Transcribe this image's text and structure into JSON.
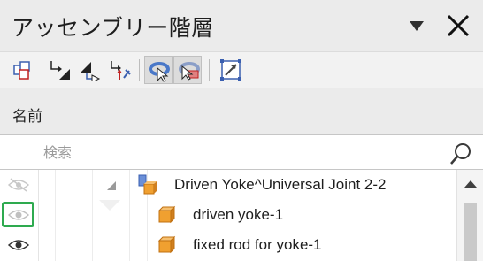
{
  "window": {
    "title": "アッセンブリー階層",
    "dropdown_icon": "chevron-down-icon",
    "close_icon": "close-icon"
  },
  "toolbar": {
    "buttons": [
      {
        "icon": "assembly-structure-icon",
        "toggled": false
      },
      {
        "icon": "sort-hierarchy-icon",
        "toggled": false
      },
      {
        "icon": "expand-collapse-icon",
        "toggled": false
      },
      {
        "icon": "constraint-link-icon",
        "toggled": false
      },
      {
        "icon": "select-ring-icon",
        "toggled": true
      },
      {
        "icon": "deselect-ring-icon",
        "toggled": true
      },
      {
        "icon": "fit-view-icon",
        "toggled": false
      }
    ]
  },
  "column_header": {
    "label": "名前"
  },
  "search": {
    "placeholder": "検索",
    "value": "",
    "icon": "search-icon"
  },
  "tree": {
    "rows": [
      {
        "label": "Driven Yoke^Universal Joint 2-2",
        "type": "assembly",
        "expanded": true,
        "visibility": "hidden"
      },
      {
        "label": "driven yoke-1",
        "type": "part",
        "visibility": "partial",
        "highlighted": true
      },
      {
        "label": "fixed rod for yoke-1",
        "type": "part",
        "visibility": "visible"
      }
    ]
  },
  "colors": {
    "highlight": "#2eaa4f",
    "part_orange": "#f0a030",
    "assembly_blue": "#4a78c8"
  }
}
